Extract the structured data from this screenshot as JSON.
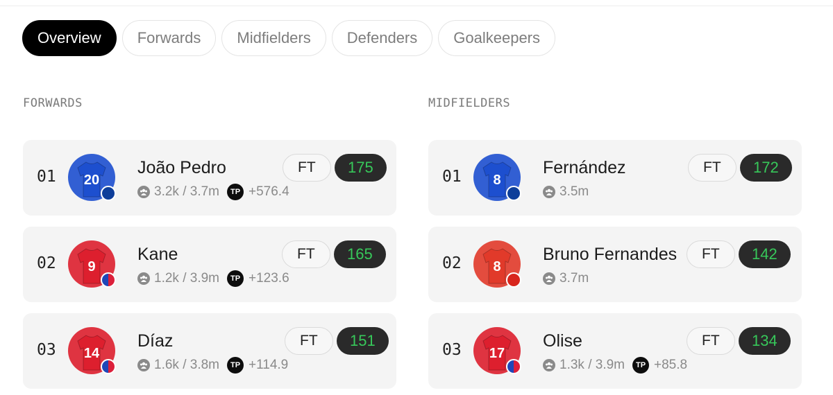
{
  "tabs": [
    "Overview",
    "Forwards",
    "Midfielders",
    "Defenders",
    "Goalkeepers"
  ],
  "active_tab": "Overview",
  "sections": {
    "forwards": {
      "title": "FORWARDS",
      "players": [
        {
          "rank": "01",
          "name": "João Pedro",
          "number": "20",
          "shirt_color": "#1d4fcf",
          "badge_colors": [
            "#0e3e9a",
            "#0e3e9a"
          ],
          "managers": "3.2k / 3.7m",
          "tp": "+576.4",
          "tag": "FT",
          "score": "175"
        },
        {
          "rank": "02",
          "name": "Kane",
          "number": "9",
          "shirt_color": "#dd1f2e",
          "badge_colors": [
            "#1f47b8",
            "#dc1f3a"
          ],
          "managers": "1.2k / 3.9m",
          "tp": "+123.6",
          "tag": "FT",
          "score": "165"
        },
        {
          "rank": "03",
          "name": "Díaz",
          "number": "14",
          "shirt_color": "#dd1f2e",
          "badge_colors": [
            "#1f47b8",
            "#dc1f3a"
          ],
          "managers": "1.6k / 3.8m",
          "tp": "+114.9",
          "tag": "FT",
          "score": "151"
        }
      ]
    },
    "midfielders": {
      "title": "MIDFIELDERS",
      "players": [
        {
          "rank": "01",
          "name": "Fernández",
          "number": "8",
          "shirt_color": "#1d4fcf",
          "badge_colors": [
            "#0e3e9a",
            "#0e3e9a"
          ],
          "managers": "3.5m",
          "tag": "FT",
          "score": "172"
        },
        {
          "rank": "02",
          "name": "Bruno Fernandes",
          "number": "8",
          "shirt_color": "#e13a2a",
          "badge_colors": [
            "#d8261d",
            "#d8261d"
          ],
          "managers": "3.7m",
          "tag": "FT",
          "score": "142"
        },
        {
          "rank": "03",
          "name": "Olise",
          "number": "17",
          "shirt_color": "#dd1f2e",
          "badge_colors": [
            "#1f47b8",
            "#dc1f3a"
          ],
          "managers": "1.3k / 3.9m",
          "tp": "+85.8",
          "tag": "FT",
          "score": "134"
        }
      ]
    }
  },
  "icons": {
    "managers": "people-icon",
    "tp": "TP"
  }
}
